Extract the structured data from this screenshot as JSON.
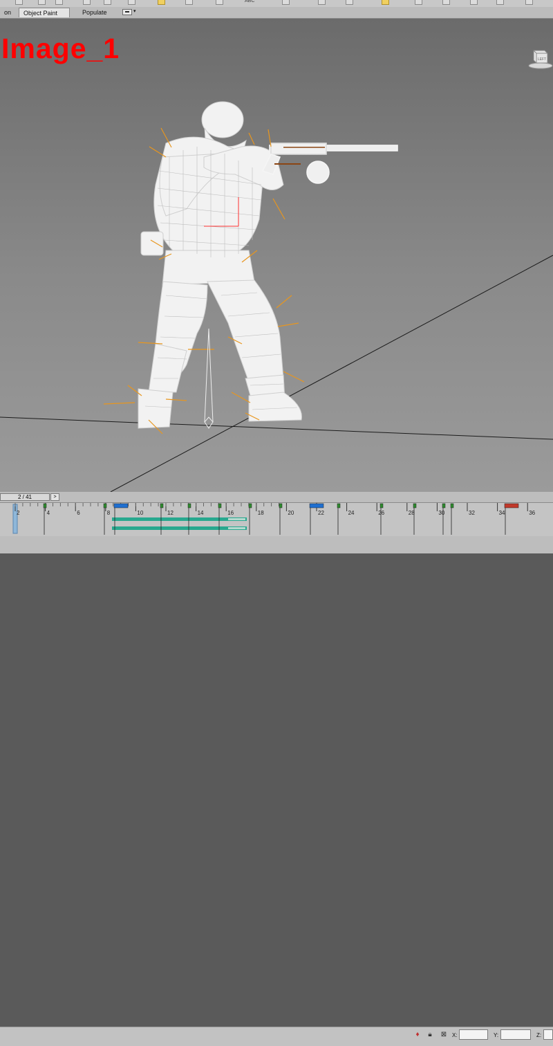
{
  "ribbon": {
    "tabs": [
      {
        "label": "on"
      },
      {
        "label": "Object Paint"
      },
      {
        "label": "Populate"
      }
    ],
    "active_tab": "Object Paint"
  },
  "viewport": {
    "overlay_label": "Image_1",
    "overlay_color": "#ff0000",
    "viewcube_label": "LEFT"
  },
  "timeline": {
    "frame_indicator": "2 / 41",
    "next_button": ">",
    "current_frame": 2,
    "ticks": [
      "2",
      "4",
      "6",
      "8",
      "10",
      "12",
      "14",
      "16",
      "18",
      "20",
      "22",
      "24",
      "26",
      "28",
      "30",
      "32",
      "34",
      "36"
    ]
  },
  "statusbar": {
    "x_label": "X:",
    "y_label": "Y:",
    "z_label": "Z:",
    "x_value": "",
    "y_value": "",
    "z_value": ""
  },
  "icons": [
    "key-icon",
    "lock-icon",
    "selection-lock-icon",
    "absolute-mode-icon",
    "viewcube-icon"
  ]
}
